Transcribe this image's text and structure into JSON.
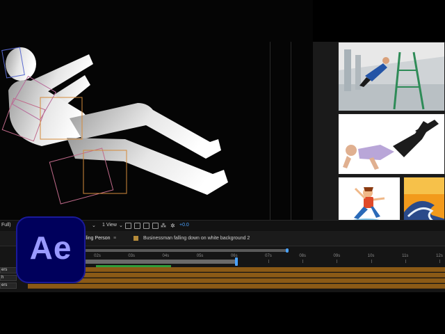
{
  "viewer": {
    "left_crop_label": "Full)",
    "view_select": "1 View",
    "exposure_value": "+0.0"
  },
  "composition_tabs": [
    {
      "label": "lling Person",
      "active": true
    },
    {
      "label": "Businessman falling down on white background 2",
      "active": false
    }
  ],
  "timeline": {
    "ruler_labels": [
      "02s",
      "03s",
      "04s",
      "05s",
      "06s",
      "07s",
      "08s",
      "09s",
      "10s",
      "11s",
      "12s"
    ],
    "left_rows": [
      "ers",
      "h",
      "ers"
    ],
    "work_area_fraction": 0.56,
    "playhead_label": "06s"
  },
  "logo": {
    "text": "Ae",
    "bg": "#00005c",
    "fg": "#9999ff"
  },
  "colors": {
    "track": "#8b5a16",
    "accent": "#4aa2ff",
    "handles": "#d48a3a"
  },
  "reference_images": [
    {
      "name": "ladder-fall-photo",
      "icon": "person-falling-from-ladder"
    },
    {
      "name": "businessman-falling-photo",
      "icon": "businessman-falling"
    },
    {
      "name": "cartoon-slip-photo",
      "icon": "cartoon-person-slipping"
    },
    {
      "name": "wave-painting",
      "icon": "wave-art"
    }
  ]
}
